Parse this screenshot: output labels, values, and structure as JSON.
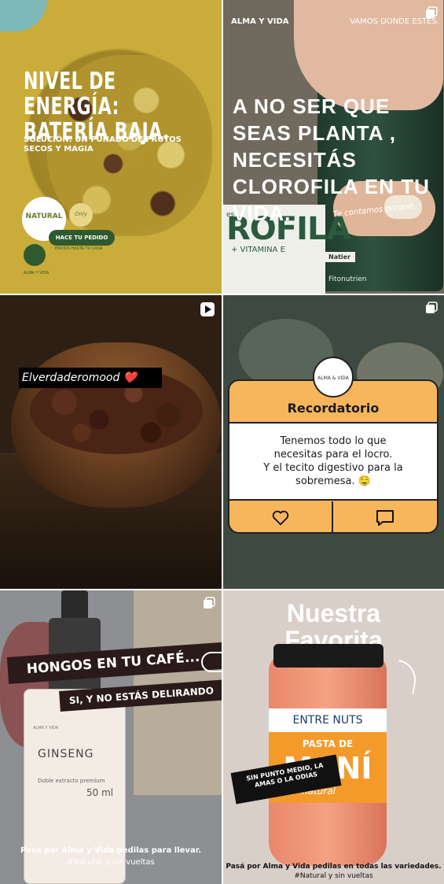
{
  "tiles": [
    {
      "headline": "NIVEL DE ENERGÍA: BATERÍA BAJA.",
      "sub": "SOLUCIÓN: UN PUÑADO DE FRUTOS SECOS Y MAGIA",
      "badge_natural": "NATURAL",
      "badge_only": "Only",
      "order_button": "HACE TU PEDIDO",
      "order_sub": "ENVÍOS HASTA TU CASA",
      "foot_note": "ALMA Y VIDA"
    },
    {
      "brand": "ALMA Y VIDA",
      "slogan": "VAMOS DONDE ESTÉS.",
      "headline": "A NO SER QUE SEAS PLANTA , NECESITÁS CLOROFILA EN TU VIDA.",
      "handwrite": "Te contamos porque",
      "label_big": "ROFILA",
      "label_es": "es",
      "label_small": "+ VITAMINA E",
      "natier": "Natier",
      "fitonut": "Fitonutrien"
    },
    {
      "caption": "Elverdaderomood ❤️"
    },
    {
      "logo": "ALMA & VIDA",
      "card_title": "Recordatorio",
      "card_lines": [
        "Tenemos todo lo que",
        "necesitas para el locro.",
        "Y el tecito digestivo para la",
        "sobremesa. 🤤"
      ]
    },
    {
      "banner1": "HONGOS EN TU CAFÉ...",
      "banner2": "SI, Y NO ESTÁS DELIRANDO",
      "ginseng": "GINSENG",
      "doble": "Doble extracto premium",
      "ml": "50 ml",
      "brand_small": "ALMA Y VIDA",
      "foot1": "Pasá por Alma y Vida pedilas para llevar.",
      "foot2": "#Natural y sin vueltas"
    },
    {
      "title_line1": "Nuestra",
      "title_line2": "Favorita",
      "brandbar": "ENTRE NUTS",
      "pasta": "PASTA DE",
      "mani": "MANÍ",
      "natural": "natural",
      "sticker": "SIN PUNTO MEDIO, LA AMAS O LA ODIAS",
      "foot1": "Pasá por Alma y Vida pedilas en todas las variedades.",
      "foot2": "#Natural y sin vueltas"
    }
  ],
  "icons": {
    "multi": "carousel-icon",
    "reel": "reel-icon",
    "heart": "heart-icon",
    "comment": "comment-icon"
  }
}
